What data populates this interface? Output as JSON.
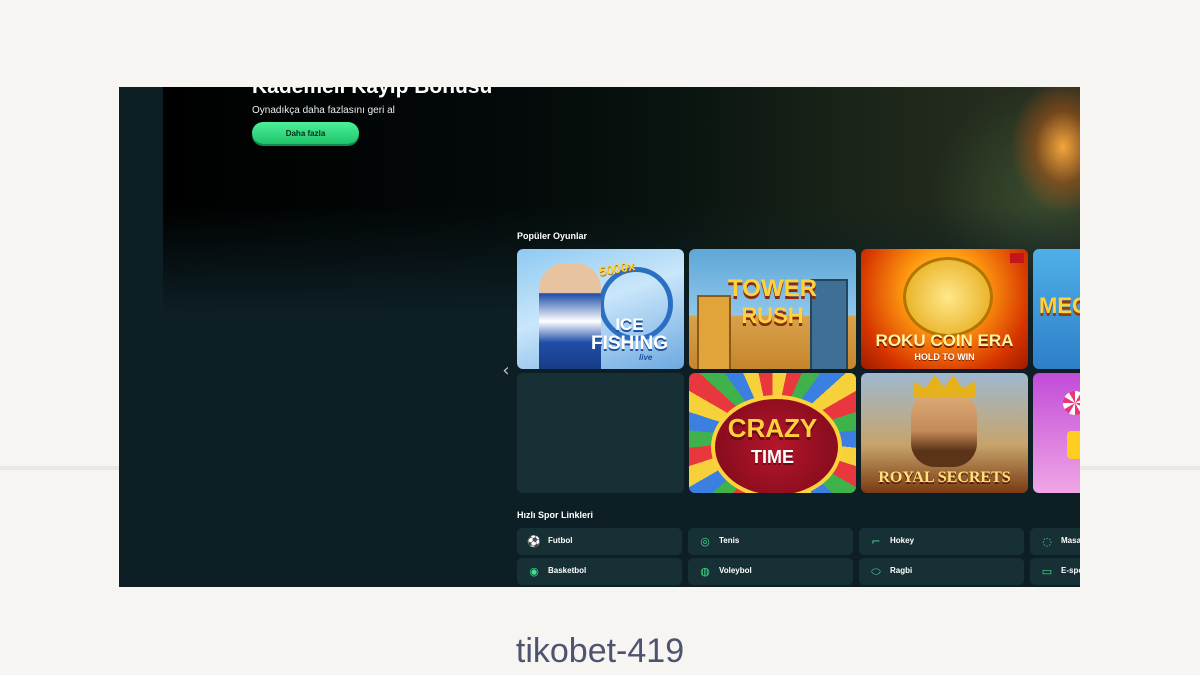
{
  "hero": {
    "title": "Kademeli Kayıp Bonusu",
    "subtitle": "Oynadıkça daha fazlasını geri al",
    "button_label": "Daha fazla"
  },
  "popular_games": {
    "title": "Popüler Oyunlar",
    "games": [
      {
        "name": "Ice Fishing",
        "lines": [
          "ICE",
          "FISHING"
        ],
        "multiplier": "5000x",
        "tag": "live"
      },
      {
        "name": "Tower Rush",
        "lines": [
          "TOWER",
          "RUSH"
        ]
      },
      {
        "name": "Roku Coin Era",
        "lines": [
          "ROKU COIN ERA",
          "HOLD TO WIN"
        ]
      },
      {
        "name": "Mega",
        "lines": [
          "MEG"
        ]
      },
      {
        "name": "Crazy Time",
        "lines": [
          "CRAZY",
          "TIME"
        ]
      },
      {
        "name": "Royal Secrets",
        "lines": [
          "ROYAL SECRETS"
        ]
      }
    ]
  },
  "sports": {
    "title": "Hızlı Spor Linkleri",
    "items": [
      {
        "label": "Futbol",
        "icon": "soccer-ball-icon"
      },
      {
        "label": "Tenis",
        "icon": "tennis-racket-icon"
      },
      {
        "label": "Hokey",
        "icon": "hockey-stick-icon"
      },
      {
        "label": "Masa",
        "icon": "table-tennis-icon"
      },
      {
        "label": "Basketbol",
        "icon": "basketball-icon"
      },
      {
        "label": "Voleybol",
        "icon": "volleyball-icon"
      },
      {
        "label": "Ragbi",
        "icon": "rugby-ball-icon"
      },
      {
        "label": "E-spo",
        "icon": "gamepad-icon"
      }
    ]
  },
  "caption": "tikobet-419",
  "colors": {
    "page_bg": "#f6f5f2",
    "app_bg": "#0d1f25",
    "tile_bg": "#173036",
    "accent_green": "#3fe08c"
  }
}
